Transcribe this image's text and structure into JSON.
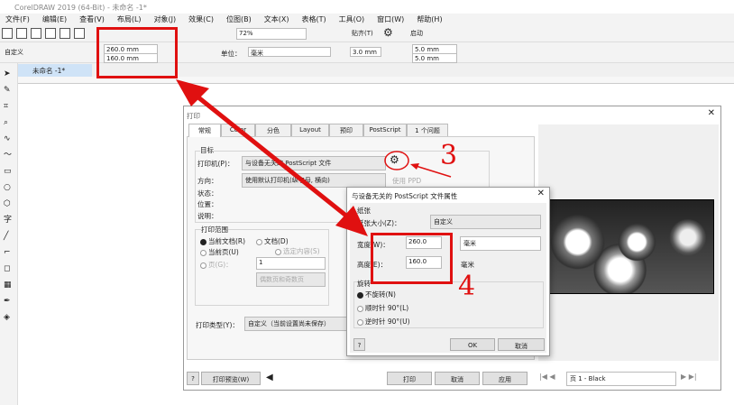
{
  "window": {
    "title": "CorelDRAW 2019 (64-Bit) - 未命名 -1*"
  },
  "menu": [
    "文件(F)",
    "编辑(E)",
    "查看(V)",
    "布局(L)",
    "对象(J)",
    "效果(C)",
    "位图(B)",
    "文本(X)",
    "表格(T)",
    "工具(O)",
    "窗口(W)",
    "帮助(H)"
  ],
  "toolbar": {
    "zoom": "72%",
    "snap": "贴齐(T)",
    "launch": "启动"
  },
  "propbar": {
    "preset": "自定义",
    "width": "260.0 mm",
    "height": "160.0 mm",
    "unit_label": "单位：",
    "unit": "毫米",
    "nudge": "3.0 mm",
    "dup_x": "5.0 mm",
    "dup_y": "5.0 mm"
  },
  "doc_tab": "未命名 -1*",
  "print_dialog": {
    "title": "打印",
    "tabs": [
      "常规",
      "Color",
      "分色",
      "Layout",
      "预印",
      "PostScript",
      "1 个问题"
    ],
    "target_group": "目标",
    "printer_label": "打印机(P)：",
    "printer": "与设备无关的 PostScript 文件",
    "orientation_label": "方向：",
    "orientation": "使用默认打印机(纵字母, 横向)",
    "use_ppd": "使用 PPD",
    "status_label": "状态：",
    "location_label": "位置：",
    "comment_label": "说明：",
    "range_group": "打印范围",
    "range_current_doc": "当前文档(R)",
    "range_documents": "文档(D)",
    "range_current_page": "当前页(U)",
    "range_selection": "选定内容(S)",
    "range_pages": "页(G)：",
    "pages_value": "1",
    "pages_mode": "偶数页和奇数页",
    "style_label": "打印类型(Y)：",
    "style": "自定义（当前设置尚未保存）",
    "help": "?",
    "preview": "打印预览(W)",
    "print": "打印",
    "cancel": "取消",
    "apply": "应用",
    "page_nav": "页 1 - Black"
  },
  "props_dialog": {
    "title": "与设备无关的 PostScript 文件属性",
    "paper_group": "纸张",
    "size_label": "纸张大小(Z)：",
    "size": "自定义",
    "width_label": "宽度(W)：",
    "width": "260.0",
    "width_unit": "毫米",
    "height_label": "高度(E)：",
    "height": "160.0",
    "height_unit": "毫米",
    "rotate_group": "旋转",
    "no_rotate": "不旋转(N)",
    "cw": "顺时针 90°(L)",
    "ccw": "逆时针 90°(U)",
    "help": "?",
    "ok": "OK",
    "cancel": "取消"
  },
  "annotations": {
    "step3": "3",
    "step4": "4",
    "color": "#e01010"
  }
}
